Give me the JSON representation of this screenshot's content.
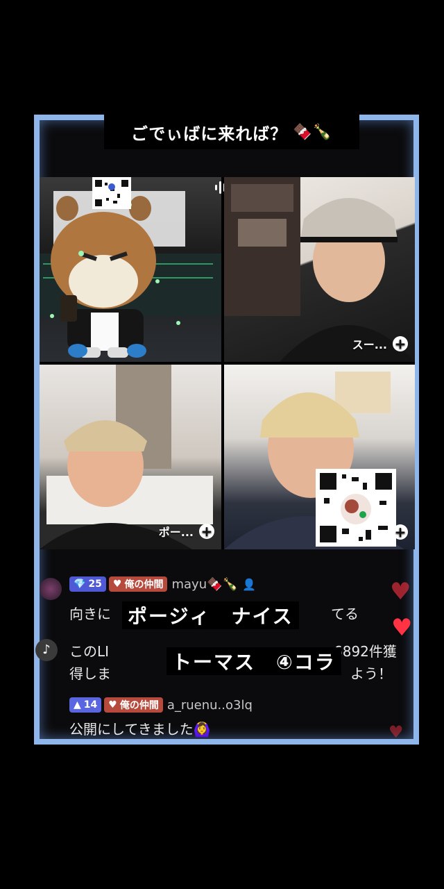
{
  "title": {
    "text": "ごでぃばに来れば？",
    "emoji": "🍫🍾"
  },
  "panels": [
    {
      "id": "hamster",
      "name": ""
    },
    {
      "id": "guest2",
      "name": "スー..."
    },
    {
      "id": "guest3",
      "name": "ポー..."
    },
    {
      "id": "guest4",
      "name": ""
    }
  ],
  "plus_symbol": "+",
  "comments": [
    {
      "level": "25",
      "group_badge": "俺の仲間",
      "user": "mayu🍫🍾",
      "text_left": "向きに",
      "text_right": "てる"
    },
    {
      "text_line1_left": "このLI",
      "text_line1_right": "6892件獲",
      "text_line2_left": "得しま",
      "text_line2_right": "よう！"
    },
    {
      "level": "14",
      "group_badge": "俺の仲間",
      "user": "a_ruenu..o3lq",
      "text": "公開にしてきました🙆‍♀️"
    }
  ],
  "overlay": {
    "line1": "ポージィ　ナイス",
    "line2": "トーマス　④コラ"
  },
  "colors": {
    "frame_border": "#8fb6ea",
    "level_badge": "#4f59d6",
    "group_badge": "#b64a3d",
    "heart": "#ff3344"
  }
}
